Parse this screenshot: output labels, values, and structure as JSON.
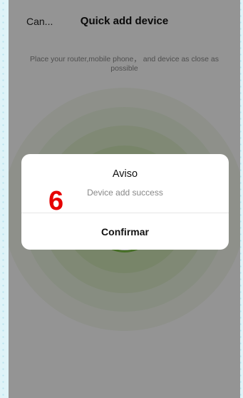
{
  "header": {
    "cancel_label": "Can...",
    "title": "Quick add device"
  },
  "instruction": "Place your router,mobile phone， and device as close as possible",
  "dialog": {
    "title": "Aviso",
    "message": "Device add success",
    "confirm_label": "Confirmar"
  },
  "annotation": {
    "step_number": "6",
    "color": "#e60000"
  },
  "colors": {
    "accent": "#7bbf44",
    "ripple": "#cfe5b6"
  }
}
